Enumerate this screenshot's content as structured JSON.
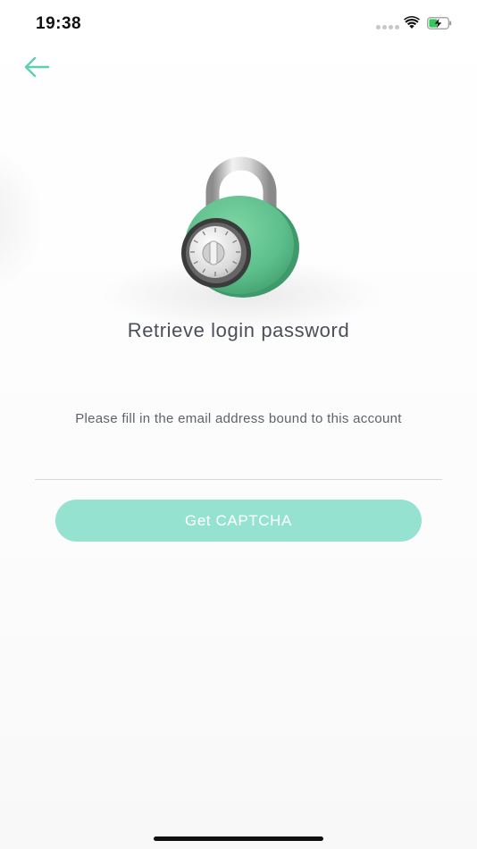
{
  "status_bar": {
    "time": "19:38"
  },
  "nav": {
    "back_icon": "arrow-left-icon"
  },
  "illustration": {
    "icon": "combination-padlock-icon"
  },
  "page": {
    "title": "Retrieve login password",
    "hint": "Please fill in the email address bound to this account"
  },
  "email": {
    "value": "",
    "placeholder": ""
  },
  "actions": {
    "captcha_label": "Get CAPTCHA"
  },
  "colors": {
    "accent": "#5dcfb2",
    "button": "#96e2d0",
    "lock_body": "#5dbf8c",
    "title_text": "#4a4f5a"
  }
}
